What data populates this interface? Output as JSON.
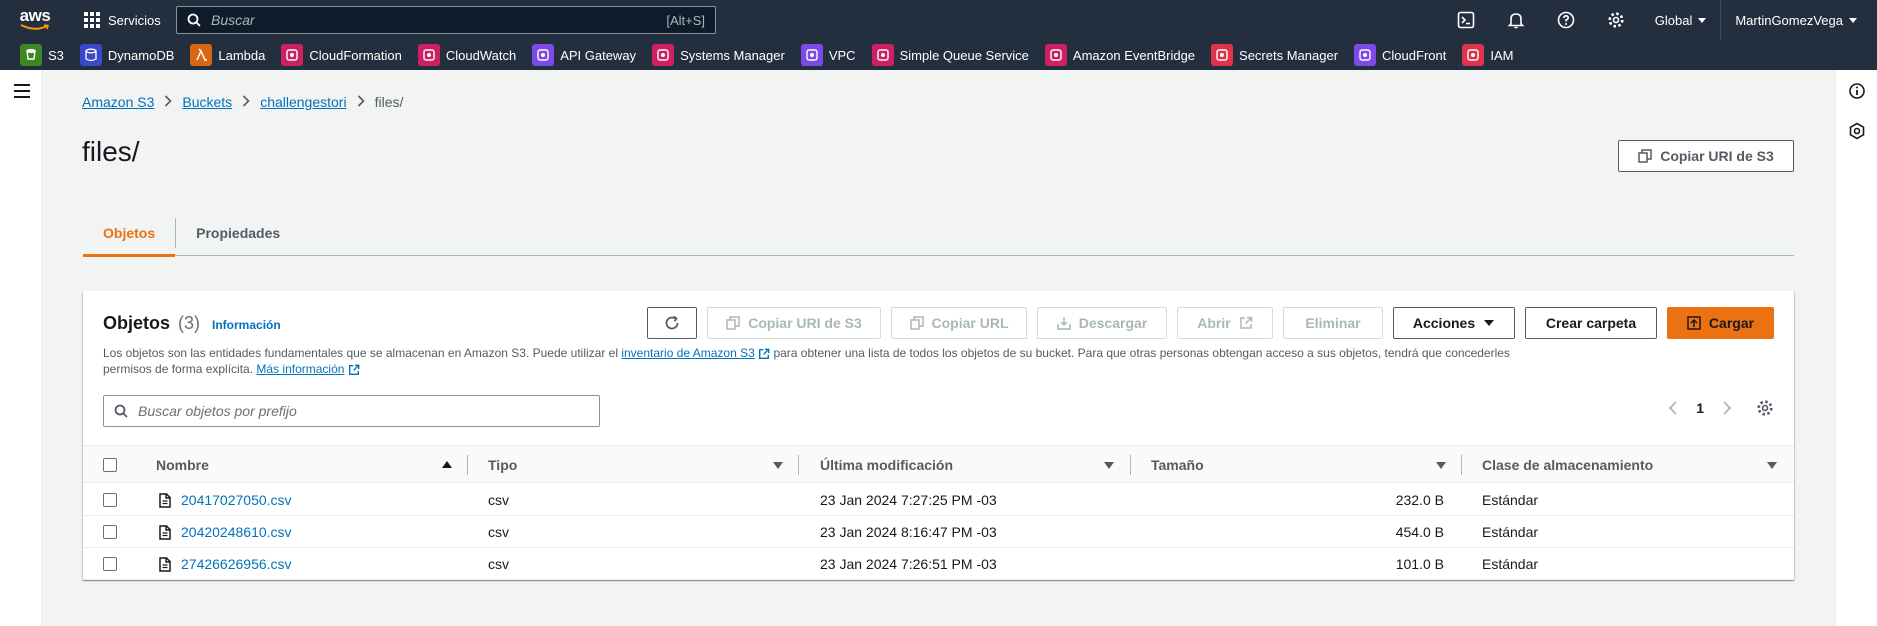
{
  "topnav": {
    "logo_text": "aws",
    "services_label": "Servicios",
    "search_placeholder": "Buscar",
    "search_shortcut": "[Alt+S]",
    "region": "Global",
    "user": "MartinGomezVega"
  },
  "favorites": [
    {
      "label": "S3",
      "color": "#3f8624"
    },
    {
      "label": "DynamoDB",
      "color": "#3b48cc"
    },
    {
      "label": "Lambda",
      "color": "#d86613"
    },
    {
      "label": "CloudFormation",
      "color": "#cc2264"
    },
    {
      "label": "CloudWatch",
      "color": "#cc2264"
    },
    {
      "label": "API Gateway",
      "color": "#7d4ae8"
    },
    {
      "label": "Systems Manager",
      "color": "#cc2264"
    },
    {
      "label": "VPC",
      "color": "#7d4ae8"
    },
    {
      "label": "Simple Queue Service",
      "color": "#cc2264"
    },
    {
      "label": "Amazon EventBridge",
      "color": "#cc2264"
    },
    {
      "label": "Secrets Manager",
      "color": "#dd344c"
    },
    {
      "label": "CloudFront",
      "color": "#7d4ae8"
    },
    {
      "label": "IAM",
      "color": "#dd344c"
    }
  ],
  "breadcrumb": {
    "items": [
      "Amazon S3",
      "Buckets",
      "challengestori"
    ],
    "current": "files/"
  },
  "page": {
    "title": "files/",
    "copy_uri_button": "Copiar URI de S3"
  },
  "tabs": [
    {
      "label": "Objetos",
      "active": true
    },
    {
      "label": "Propiedades",
      "active": false
    }
  ],
  "objects_panel": {
    "heading": "Objetos",
    "count": "(3)",
    "info_link": "Información",
    "desc_1": "Los objetos son las entidades fundamentales que se almacenan en Amazon S3. Puede utilizar el ",
    "desc_link_1": "inventario de Amazon S3",
    "desc_2": " para obtener una lista de todos los objetos de su bucket. Para que otras personas obtengan acceso a sus objetos, tendrá que concederles permisos de forma explícita. ",
    "desc_link_2": "Más información",
    "actions": {
      "copy_uri": "Copiar URI de S3",
      "copy_url": "Copiar URL",
      "download": "Descargar",
      "open": "Abrir",
      "delete": "Eliminar",
      "actions": "Acciones",
      "create_folder": "Crear carpeta",
      "upload": "Cargar"
    },
    "search_placeholder": "Buscar objetos por prefijo",
    "page_number": "1",
    "columns": {
      "name": "Nombre",
      "type": "Tipo",
      "modified": "Última modificación",
      "size": "Tamaño",
      "storage_class": "Clase de almacenamiento"
    },
    "rows": [
      {
        "name": "20417027050.csv",
        "type": "csv",
        "modified": "23 Jan 2024 7:27:25 PM -03",
        "size": "232.0 B",
        "storage_class": "Estándar"
      },
      {
        "name": "20420248610.csv",
        "type": "csv",
        "modified": "23 Jan 2024 8:16:47 PM -03",
        "size": "454.0 B",
        "storage_class": "Estándar"
      },
      {
        "name": "27426626956.csv",
        "type": "csv",
        "modified": "23 Jan 2024 7:26:51 PM -03",
        "size": "101.0 B",
        "storage_class": "Estándar"
      }
    ]
  },
  "colors": {
    "nav_bg": "#232f3e",
    "accent": "#ec7211",
    "link": "#0073bb"
  }
}
